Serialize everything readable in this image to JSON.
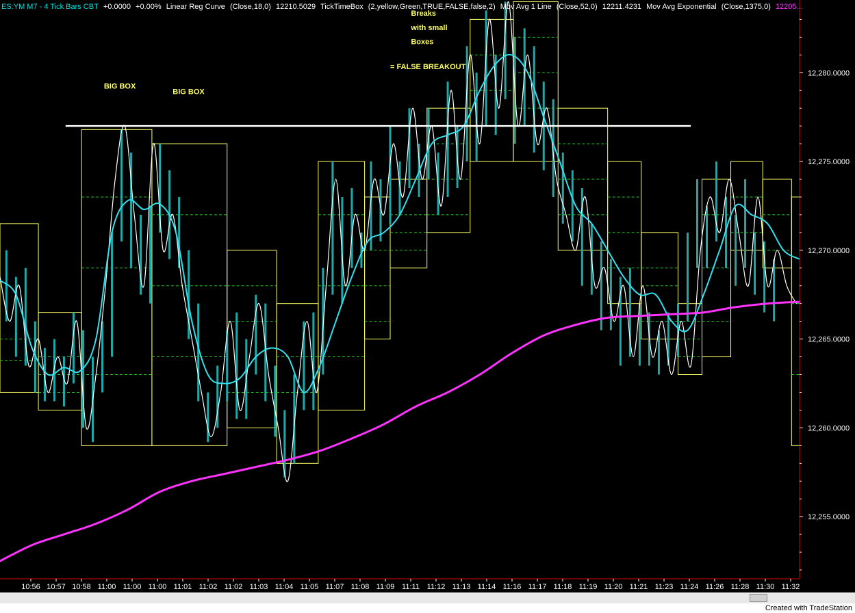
{
  "status": {
    "symbol": "ES:YM M7 - 4 Tick Bars  CBT",
    "change": "+0.0000",
    "change_pct": "+0.00%",
    "ind1_name": "Linear Reg Curve",
    "ind1_params": "(Close,18,0)",
    "ind1_value": "12210.5029",
    "ind2_name": "TickTimeBox",
    "ind2_params": "(2,yellow,Green,TRUE,FALSE,false,2)",
    "ind3_name": "Mov Avg 1 Line",
    "ind3_params": "(Close,52,0)",
    "ind3_value": "12211.4231",
    "ind4_name": "Mov Avg Exponential",
    "ind4_params": "(Close,1375,0)",
    "ind4_value": "12205..."
  },
  "credit": "Created with TradeStation",
  "colors": {
    "price": "#1ea8a8",
    "linreg": "#ffffff",
    "sma": "#33e0f0",
    "ema": "#ff33ff",
    "box_border": "#ffff66",
    "box_level": "#22cc22",
    "resistance": "#ffffff",
    "annotation": "#ffff66",
    "axis_text": "#ffffff"
  },
  "chart_data": {
    "type": "line",
    "yaxis_ticks": [
      "12,280.0000",
      "12,275.0000",
      "12,270.0000",
      "12,265.0000",
      "12,260.0000",
      "12,255.0000"
    ],
    "tick_values": [
      12280,
      12275,
      12270,
      12265,
      12260,
      12255
    ],
    "xaxis_labels": [
      "10:56",
      "10:57",
      "10:58",
      "11:00",
      "11:00",
      "11:00",
      "11:01",
      "11:02",
      "11:02",
      "11:03",
      "11:04",
      "11:05",
      "11:07",
      "11:08",
      "11:09",
      "11:11",
      "11:12",
      "11:13",
      "11:14",
      "11:16",
      "11:17",
      "11:18",
      "11:19",
      "11:20",
      "11:21",
      "11:23",
      "11:24",
      "11:26",
      "11:28",
      "11:30",
      "11:32"
    ],
    "ylim": [
      12251.5,
      12283.4
    ],
    "grid": false,
    "annotations": [
      {
        "text": "BIG BOX",
        "x": 6.5,
        "y": 12279.1
      },
      {
        "text": "BIG BOX",
        "x": 10.8,
        "y": 12278.8
      },
      {
        "text": "Breaks",
        "x": 25.7,
        "y": 12283.2
      },
      {
        "text": "with small",
        "x": 25.7,
        "y": 12282.4
      },
      {
        "text": "Boxes",
        "x": 25.7,
        "y": 12281.6
      },
      {
        "text": "= FALSE BREAKOUT",
        "x": 24.4,
        "y": 12280.2
      }
    ],
    "resistance_line": {
      "y": 12277.0,
      "x_start": 4.1,
      "x_end": 43.2
    },
    "boxes": [
      {
        "x1": 0,
        "x2": 2.4,
        "high": 12271.5,
        "low": 12262.0
      },
      {
        "x1": 2.4,
        "x2": 5.1,
        "high": 12266.5,
        "low": 12261.0
      },
      {
        "x1": 5.1,
        "x2": 9.5,
        "high": 12276.8,
        "low": 12259.0
      },
      {
        "x1": 9.5,
        "x2": 14.2,
        "high": 12276.0,
        "low": 12259.0
      },
      {
        "x1": 14.2,
        "x2": 17.3,
        "high": 12270.0,
        "low": 12260.0
      },
      {
        "x1": 17.3,
        "x2": 19.9,
        "high": 12267.0,
        "low": 12258.0
      },
      {
        "x1": 19.9,
        "x2": 22.8,
        "high": 12275.0,
        "low": 12261.0
      },
      {
        "x1": 22.8,
        "x2": 24.4,
        "high": 12273.0,
        "low": 12265.0
      },
      {
        "x1": 24.4,
        "x2": 26.7,
        "high": 12274.0,
        "low": 12269.0
      },
      {
        "x1": 26.7,
        "x2": 29.4,
        "high": 12278.0,
        "low": 12271.0
      },
      {
        "x1": 29.4,
        "x2": 32.1,
        "high": 12283.0,
        "low": 12275.0
      },
      {
        "x1": 32.1,
        "x2": 34.9,
        "high": 12284.0,
        "low": 12275.0
      },
      {
        "x1": 34.9,
        "x2": 38.0,
        "high": 12278.0,
        "low": 12270.0
      },
      {
        "x1": 38.0,
        "x2": 40.1,
        "high": 12275.0,
        "low": 12267.0
      },
      {
        "x1": 40.1,
        "x2": 42.4,
        "high": 12271.0,
        "low": 12265.0
      },
      {
        "x1": 42.4,
        "x2": 43.9,
        "high": 12267.0,
        "low": 12263.0
      },
      {
        "x1": 43.9,
        "x2": 45.7,
        "high": 12274.0,
        "low": 12264.0
      },
      {
        "x1": 45.7,
        "x2": 47.7,
        "high": 12275.0,
        "low": 12270.0
      },
      {
        "x1": 47.7,
        "x2": 49.5,
        "high": 12274.0,
        "low": 12269.0
      },
      {
        "x1": 49.5,
        "x2": 50.0,
        "high": 12273.0,
        "low": 12259.0
      }
    ],
    "box_levels": [
      {
        "x1": 0,
        "x2": 2.4,
        "levels": [
          12265.0,
          12263.8
        ]
      },
      {
        "x1": 2.4,
        "x2": 5.1,
        "levels": [
          12264.0,
          12263.0,
          12262.0
        ]
      },
      {
        "x1": 5.1,
        "x2": 9.5,
        "levels": [
          12273.0,
          12269.0,
          12263.0
        ]
      },
      {
        "x1": 9.5,
        "x2": 14.2,
        "levels": [
          12272.0,
          12268.0,
          12264.0
        ]
      },
      {
        "x1": 14.2,
        "x2": 17.3,
        "levels": [
          12268.0,
          12266.0,
          12262.0
        ]
      },
      {
        "x1": 17.3,
        "x2": 19.9,
        "levels": [
          12264.0,
          12262.0
        ]
      },
      {
        "x1": 19.9,
        "x2": 22.8,
        "levels": [
          12272.0,
          12268.0,
          12264.0
        ]
      },
      {
        "x1": 22.8,
        "x2": 24.4,
        "levels": [
          12270.0,
          12268.0,
          12266.0
        ]
      },
      {
        "x1": 24.4,
        "x2": 26.7,
        "levels": [
          12272.0,
          12271.0,
          12270.0
        ]
      },
      {
        "x1": 26.7,
        "x2": 29.4,
        "levels": [
          12276.0,
          12274.0,
          12272.0
        ]
      },
      {
        "x1": 29.4,
        "x2": 32.1,
        "levels": [
          12281.0,
          12279.0,
          12277.0
        ]
      },
      {
        "x1": 32.1,
        "x2": 34.9,
        "levels": [
          12282.0,
          12280.0,
          12278.0
        ]
      },
      {
        "x1": 34.9,
        "x2": 38.0,
        "levels": [
          12276.0,
          12274.0,
          12272.0
        ]
      },
      {
        "x1": 38.0,
        "x2": 40.1,
        "levels": [
          12273.0,
          12271.0,
          12269.0
        ]
      },
      {
        "x1": 40.1,
        "x2": 42.4,
        "levels": [
          12269.0,
          12268.0,
          12266.0
        ]
      },
      {
        "x1": 42.4,
        "x2": 43.9,
        "levels": [
          12266.0,
          12265.0,
          12264.0
        ]
      },
      {
        "x1": 43.9,
        "x2": 45.7,
        "levels": [
          12272.0,
          12269.0,
          12266.0
        ]
      },
      {
        "x1": 45.7,
        "x2": 47.7,
        "levels": [
          12273.0,
          12271.0
        ]
      },
      {
        "x1": 47.7,
        "x2": 49.5,
        "levels": [
          12272.0,
          12270.0
        ]
      },
      {
        "x1": 49.5,
        "x2": 50.0,
        "levels": [
          12267.0,
          12263.0
        ]
      }
    ],
    "series": [
      {
        "name": "Linear Reg Curve",
        "x": [
          0,
          0.6,
          1.2,
          1.8,
          2.4,
          3.0,
          3.6,
          4.2,
          4.8,
          5.4,
          6.0,
          6.6,
          7.2,
          7.8,
          8.4,
          9.0,
          9.6,
          10.2,
          10.8,
          11.4,
          12.0,
          12.6,
          13.2,
          13.8,
          14.4,
          15.0,
          15.6,
          16.2,
          16.8,
          17.4,
          18.0,
          18.6,
          19.2,
          19.8,
          20.4,
          21.0,
          21.6,
          22.2,
          22.8,
          23.4,
          24.0,
          24.6,
          25.2,
          25.8,
          26.4,
          27.0,
          27.6,
          28.2,
          28.8,
          29.4,
          30.0,
          30.6,
          31.2,
          31.8,
          32.4,
          33.0,
          33.6,
          34.2,
          34.8,
          35.4,
          36.0,
          36.6,
          37.2,
          37.8,
          38.4,
          39.0,
          39.6,
          40.2,
          40.8,
          41.4,
          42.0,
          42.6,
          43.2,
          43.8,
          44.4,
          45.0,
          45.6,
          46.2,
          46.8,
          47.4,
          48.0,
          48.6,
          49.2,
          49.8
        ],
        "values": [
          12268.5,
          12266.0,
          12268.0,
          12263.5,
          12265.0,
          12262.0,
          12264.0,
          12262.5,
          12266.0,
          12260.0,
          12263.0,
          12268.0,
          12274.0,
          12277.0,
          12272.0,
          12268.0,
          12276.0,
          12270.0,
          12272.0,
          12268.0,
          12265.0,
          12262.0,
          12259.5,
          12262.0,
          12266.0,
          12261.0,
          12264.0,
          12267.0,
          12263.0,
          12260.0,
          12257.0,
          12262.0,
          12266.0,
          12262.0,
          12268.0,
          12274.0,
          12268.0,
          12272.0,
          12270.0,
          12274.0,
          12272.0,
          12276.0,
          12273.0,
          12278.0,
          12274.0,
          12277.0,
          12272.5,
          12279.0,
          12274.0,
          12281.0,
          12276.0,
          12283.0,
          12278.0,
          12284.0,
          12277.0,
          12281.0,
          12276.0,
          12278.0,
          12274.0,
          12272.0,
          12270.0,
          12273.0,
          12268.0,
          12269.0,
          12266.0,
          12268.0,
          12264.0,
          12268.0,
          12264.0,
          12266.0,
          12263.0,
          12266.0,
          12263.5,
          12270.0,
          12273.0,
          12271.0,
          12274.0,
          12271.0,
          12268.0,
          12273.0,
          12268.0,
          12270.0,
          12268.0,
          12267.0
        ]
      },
      {
        "name": "Mov Avg 1 Line",
        "x": [
          0,
          1,
          2,
          3,
          4,
          5,
          6,
          7,
          8,
          9,
          10,
          11,
          12,
          13,
          14,
          15,
          16,
          17,
          18,
          19,
          20,
          21,
          22,
          23,
          24,
          25,
          26,
          27,
          28,
          29,
          30,
          31,
          32,
          33,
          34,
          35,
          36,
          37,
          38,
          39,
          40,
          41,
          42,
          43,
          44,
          45,
          46,
          47,
          48,
          49,
          50
        ],
        "values": [
          12268.3,
          12267.5,
          12264.5,
          12263.0,
          12263.4,
          12263.2,
          12265.0,
          12271.0,
          12272.8,
          12272.3,
          12272.6,
          12271.0,
          12266.0,
          12263.0,
          12262.5,
          12262.8,
          12264.0,
          12264.5,
          12264.0,
          12262.0,
          12263.5,
          12266.0,
          12268.5,
          12270.5,
          12271.0,
          12272.0,
          12274.0,
          12276.0,
          12276.5,
          12277.0,
          12279.0,
          12280.5,
          12281.0,
          12280.0,
          12277.5,
          12275.0,
          12272.5,
          12271.5,
          12270.0,
          12268.5,
          12267.5,
          12267.5,
          12266.0,
          12265.5,
          12267.5,
          12270.0,
          12272.5,
          12272.0,
          12271.5,
          12270.0,
          12269.5
        ]
      },
      {
        "name": "Mov Avg Exponential",
        "x": [
          0,
          2,
          4,
          6,
          8,
          10,
          12,
          14,
          16,
          18,
          20,
          22,
          24,
          26,
          28,
          30,
          32,
          34,
          36,
          38,
          40,
          42,
          44,
          46,
          48,
          50
        ],
        "values": [
          12252.5,
          12253.4,
          12254.0,
          12254.6,
          12255.4,
          12256.4,
          12257.0,
          12257.4,
          12257.8,
          12258.2,
          12258.7,
          12259.4,
          12260.2,
          12261.2,
          12262.0,
          12263.0,
          12264.2,
          12265.2,
          12265.8,
          12266.2,
          12266.3,
          12266.4,
          12266.5,
          12266.8,
          12267.0,
          12267.1
        ]
      }
    ],
    "price_bars": [
      {
        "x": 0.4,
        "high": 12270.0,
        "low": 12266.0
      },
      {
        "x": 1.0,
        "high": 12268.5,
        "low": 12264.0
      },
      {
        "x": 1.6,
        "high": 12269.0,
        "low": 12263.5
      },
      {
        "x": 2.2,
        "high": 12266.0,
        "low": 12262.0
      },
      {
        "x": 2.8,
        "high": 12264.5,
        "low": 12261.5
      },
      {
        "x": 3.4,
        "high": 12265.0,
        "low": 12261.5
      },
      {
        "x": 4.0,
        "high": 12264.0,
        "low": 12261.2
      },
      {
        "x": 4.6,
        "high": 12266.5,
        "low": 12262.5
      },
      {
        "x": 5.2,
        "high": 12265.5,
        "low": 12260.0
      },
      {
        "x": 5.8,
        "high": 12264.0,
        "low": 12259.2
      },
      {
        "x": 6.4,
        "high": 12266.0,
        "low": 12262.0
      },
      {
        "x": 7.0,
        "high": 12271.0,
        "low": 12264.0
      },
      {
        "x": 7.6,
        "high": 12276.8,
        "low": 12270.5
      },
      {
        "x": 8.2,
        "high": 12275.5,
        "low": 12269.0
      },
      {
        "x": 8.8,
        "high": 12272.0,
        "low": 12267.5
      },
      {
        "x": 9.4,
        "high": 12272.5,
        "low": 12267.0
      },
      {
        "x": 10.0,
        "high": 12276.0,
        "low": 12271.0
      },
      {
        "x": 10.6,
        "high": 12274.5,
        "low": 12269.5
      },
      {
        "x": 11.2,
        "high": 12273.0,
        "low": 12269.0
      },
      {
        "x": 11.8,
        "high": 12270.0,
        "low": 12265.0
      },
      {
        "x": 12.4,
        "high": 12267.0,
        "low": 12261.5
      },
      {
        "x": 13.0,
        "high": 12262.0,
        "low": 12259.2
      },
      {
        "x": 13.6,
        "high": 12263.5,
        "low": 12260.0
      },
      {
        "x": 14.2,
        "high": 12265.5,
        "low": 12261.5
      },
      {
        "x": 14.8,
        "high": 12266.5,
        "low": 12260.5
      },
      {
        "x": 15.4,
        "high": 12265.0,
        "low": 12260.5
      },
      {
        "x": 16.0,
        "high": 12267.5,
        "low": 12263.0
      },
      {
        "x": 16.6,
        "high": 12267.0,
        "low": 12261.5
      },
      {
        "x": 17.2,
        "high": 12263.5,
        "low": 12259.5
      },
      {
        "x": 17.8,
        "high": 12261.0,
        "low": 12257.2
      },
      {
        "x": 18.4,
        "high": 12263.0,
        "low": 12258.0
      },
      {
        "x": 19.0,
        "high": 12266.0,
        "low": 12261.0
      },
      {
        "x": 19.6,
        "high": 12266.5,
        "low": 12261.0
      },
      {
        "x": 20.2,
        "high": 12269.0,
        "low": 12263.0
      },
      {
        "x": 20.8,
        "high": 12275.0,
        "low": 12267.5
      },
      {
        "x": 21.4,
        "high": 12273.0,
        "low": 12267.0
      },
      {
        "x": 22.0,
        "high": 12273.5,
        "low": 12269.0
      },
      {
        "x": 22.6,
        "high": 12271.0,
        "low": 12269.0
      },
      {
        "x": 23.2,
        "high": 12275.0,
        "low": 12270.0
      },
      {
        "x": 23.8,
        "high": 12274.0,
        "low": 12270.5
      },
      {
        "x": 24.4,
        "high": 12277.0,
        "low": 12271.5
      },
      {
        "x": 25.0,
        "high": 12275.0,
        "low": 12272.0
      },
      {
        "x": 25.6,
        "high": 12278.0,
        "low": 12273.5
      },
      {
        "x": 26.2,
        "high": 12276.0,
        "low": 12273.0
      },
      {
        "x": 26.8,
        "high": 12278.0,
        "low": 12274.0
      },
      {
        "x": 27.4,
        "high": 12275.5,
        "low": 12272.0
      },
      {
        "x": 28.0,
        "high": 12279.5,
        "low": 12273.0
      },
      {
        "x": 28.6,
        "high": 12277.0,
        "low": 12273.5
      },
      {
        "x": 29.2,
        "high": 12281.5,
        "low": 12275.0
      },
      {
        "x": 29.8,
        "high": 12280.0,
        "low": 12275.0
      },
      {
        "x": 30.4,
        "high": 12283.5,
        "low": 12277.0
      },
      {
        "x": 31.0,
        "high": 12281.0,
        "low": 12276.5
      },
      {
        "x": 31.6,
        "high": 12284.0,
        "low": 12278.5
      },
      {
        "x": 32.2,
        "high": 12282.0,
        "low": 12276.0
      },
      {
        "x": 32.8,
        "high": 12282.5,
        "low": 12277.0
      },
      {
        "x": 33.4,
        "high": 12281.5,
        "low": 12275.5
      },
      {
        "x": 34.0,
        "high": 12279.5,
        "low": 12274.5
      },
      {
        "x": 34.6,
        "high": 12278.5,
        "low": 12273.0
      },
      {
        "x": 35.2,
        "high": 12275.5,
        "low": 12271.5
      },
      {
        "x": 35.8,
        "high": 12274.5,
        "low": 12270.5
      },
      {
        "x": 36.4,
        "high": 12273.5,
        "low": 12268.0
      },
      {
        "x": 37.0,
        "high": 12271.5,
        "low": 12267.5
      },
      {
        "x": 37.6,
        "high": 12270.5,
        "low": 12265.5
      },
      {
        "x": 38.2,
        "high": 12269.5,
        "low": 12265.5
      },
      {
        "x": 38.8,
        "high": 12268.5,
        "low": 12263.5
      },
      {
        "x": 39.4,
        "high": 12269.0,
        "low": 12264.0
      },
      {
        "x": 40.0,
        "high": 12267.0,
        "low": 12263.5
      },
      {
        "x": 40.6,
        "high": 12266.5,
        "low": 12263.5
      },
      {
        "x": 41.2,
        "high": 12265.5,
        "low": 12263.0
      },
      {
        "x": 41.8,
        "high": 12266.5,
        "low": 12263.5
      },
      {
        "x": 42.4,
        "high": 12267.0,
        "low": 12264.0
      },
      {
        "x": 43.0,
        "high": 12271.0,
        "low": 12266.0
      },
      {
        "x": 43.6,
        "high": 12274.0,
        "low": 12269.0
      },
      {
        "x": 44.2,
        "high": 12272.5,
        "low": 12269.0
      },
      {
        "x": 44.8,
        "high": 12275.0,
        "low": 12270.5
      },
      {
        "x": 45.4,
        "high": 12273.0,
        "low": 12269.0
      },
      {
        "x": 46.0,
        "high": 12272.0,
        "low": 12268.0
      },
      {
        "x": 46.6,
        "high": 12274.0,
        "low": 12269.0
      },
      {
        "x": 47.2,
        "high": 12271.0,
        "low": 12267.5
      },
      {
        "x": 47.8,
        "high": 12270.5,
        "low": 12266.5
      },
      {
        "x": 48.4,
        "high": 12269.5,
        "low": 12266.0
      }
    ]
  }
}
